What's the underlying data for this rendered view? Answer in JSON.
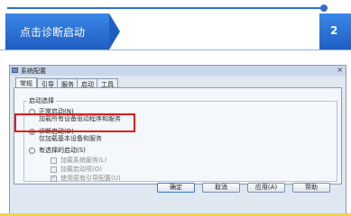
{
  "slide": {
    "title": "点击诊断启动",
    "page_number": "2"
  },
  "dialog": {
    "title": "系统配置",
    "close_glyph": "×",
    "tabs": [
      "常规",
      "引导",
      "服务",
      "启动",
      "工具"
    ],
    "active_tab": "常规",
    "group_title": "启动选择",
    "options": [
      {
        "label": "正常启动(N)",
        "description": "加载所有设备驱动程序和服务",
        "selected": false
      },
      {
        "label": "诊断启动(D)",
        "description": "仅加载基本设备和服务",
        "selected": true
      },
      {
        "label": "有选择的启动(S)",
        "description": "",
        "selected": false
      }
    ],
    "selective_items": [
      {
        "label": "加载系统服务(L)",
        "checked": false
      },
      {
        "label": "加载启动项(O)",
        "checked": false
      },
      {
        "label": "使用原有引导配置(U)",
        "checked": true
      }
    ],
    "buttons": {
      "ok": "确定",
      "cancel": "取消",
      "apply": "应用(A)",
      "help": "帮助"
    }
  },
  "colors": {
    "accent_blue": "#2f6fd1",
    "highlight_red": "#e21b1b",
    "footer_yellow": "#f2d24a"
  }
}
